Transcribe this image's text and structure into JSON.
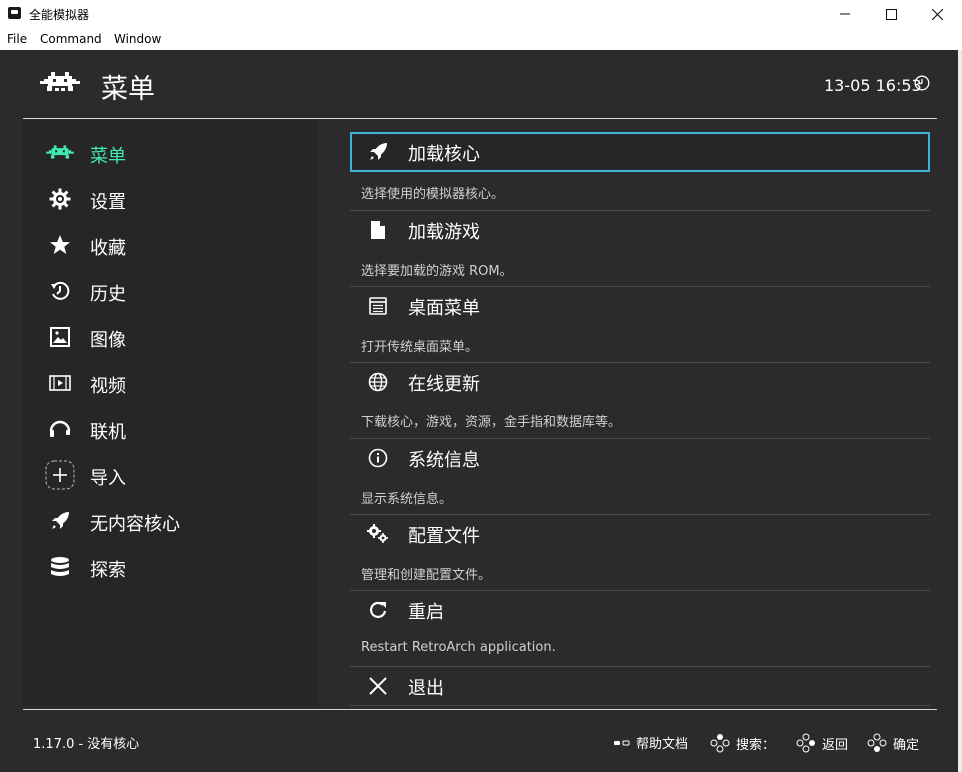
{
  "window": {
    "title": "全能模拟器",
    "menu": [
      "File",
      "Command",
      "Window"
    ]
  },
  "header": {
    "title": "菜单",
    "clock": "13-05 16:53"
  },
  "sidebar": {
    "items": [
      {
        "label": "菜单",
        "icon": "retroarch-invader-icon",
        "active": true
      },
      {
        "label": "设置",
        "icon": "gear-icon"
      },
      {
        "label": "收藏",
        "icon": "star-icon"
      },
      {
        "label": "历史",
        "icon": "history-icon"
      },
      {
        "label": "图像",
        "icon": "image-icon"
      },
      {
        "label": "视频",
        "icon": "film-icon"
      },
      {
        "label": "联机",
        "icon": "netplay-icon"
      },
      {
        "label": "导入",
        "icon": "add-icon"
      },
      {
        "label": "无内容核心",
        "icon": "rocket-icon"
      },
      {
        "label": "探索",
        "icon": "database-icon"
      }
    ]
  },
  "entries": [
    {
      "label": "加载核心",
      "desc": "选择使用的模拟器核心。",
      "icon": "rocket-icon",
      "selected": true
    },
    {
      "label": "加载游戏",
      "desc": "选择要加载的游戏 ROM。",
      "icon": "file-icon"
    },
    {
      "label": "桌面菜单",
      "desc": "打开传统桌面菜单。",
      "icon": "desktop-menu-icon"
    },
    {
      "label": "在线更新",
      "desc": "下载核心，游戏，资源，金手指和数据库等。",
      "icon": "globe-icon"
    },
    {
      "label": "系统信息",
      "desc": "显示系统信息。",
      "icon": "info-icon"
    },
    {
      "label": "配置文件",
      "desc": "管理和创建配置文件。",
      "icon": "cogs-icon"
    },
    {
      "label": "重启",
      "desc": "Restart RetroArch application.",
      "icon": "restart-icon"
    },
    {
      "label": "退出",
      "desc": "",
      "icon": "close-icon"
    }
  ],
  "footer": {
    "version": "1.17.0 - 没有核心",
    "help": "帮助文档",
    "search": "搜索：",
    "back": "返回",
    "ok": "确定"
  },
  "colors": {
    "accent": "#41ecb1",
    "selection_border": "#3fb3d6",
    "background": "#2b2b2b"
  }
}
